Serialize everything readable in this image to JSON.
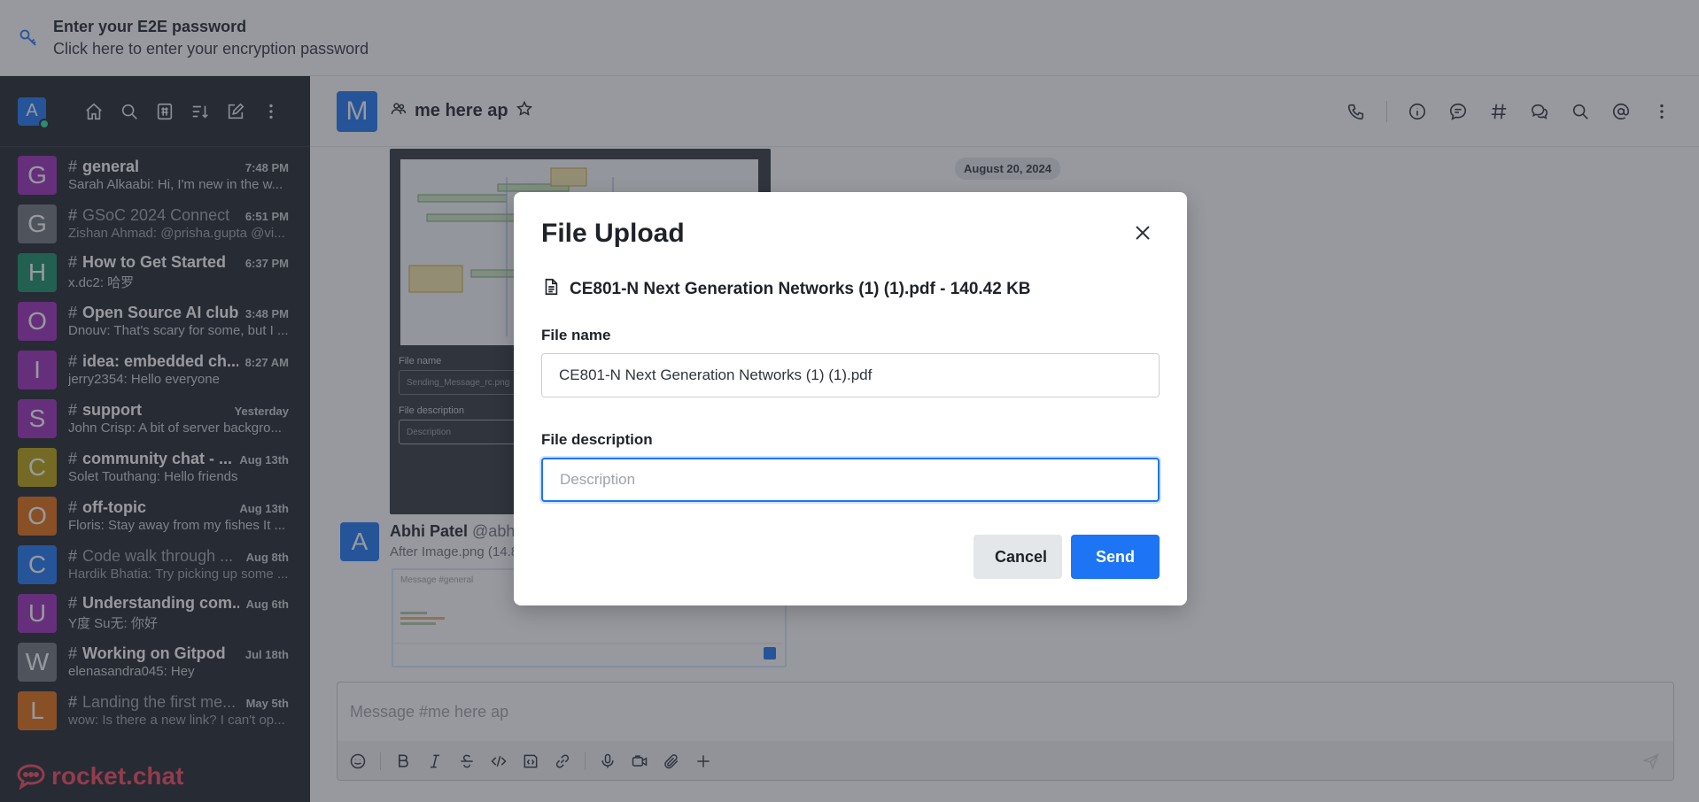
{
  "e2e_banner": {
    "title": "Enter your E2E password",
    "subtitle": "Click here to enter your encryption password"
  },
  "sidebar": {
    "user_initial": "A",
    "brand": "rocket.chat",
    "rooms": [
      {
        "initial": "G",
        "color": "#9c2bb8",
        "name": "general",
        "time": "7:48 PM",
        "last": "Sarah Alkaabi: Hi, I'm new in the w...",
        "muted": false
      },
      {
        "initial": "G",
        "color": "#6c737a",
        "name": "GSoC 2024 Connect",
        "time": "6:51 PM",
        "last": "Zishan Ahmad: @prisha.gupta @vi...",
        "muted": true
      },
      {
        "initial": "H",
        "color": "#158d65",
        "name": "How to Get Started",
        "time": "6:37 PM",
        "last": "x.dc2: 哈罗",
        "muted": false
      },
      {
        "initial": "O",
        "color": "#9c2bb8",
        "name": "Open Source AI club",
        "time": "3:48 PM",
        "last": "Dnouv: That's scary for some, but I ...",
        "muted": false
      },
      {
        "initial": "I",
        "color": "#9c2bb8",
        "name": "idea: embedded ch...",
        "time": "8:27 AM",
        "last": "jerry2354: Hello everyone",
        "muted": false
      },
      {
        "initial": "S",
        "color": "#9c2bb8",
        "name": "support",
        "time": "Yesterday",
        "last": "John Crisp: A bit of server backgro...",
        "muted": false
      },
      {
        "initial": "C",
        "color": "#b8a10b",
        "name": "community chat - ...",
        "time": "Aug 13th",
        "last": "Solet Touthang: Hello friends",
        "muted": false
      },
      {
        "initial": "O",
        "color": "#e26d0e",
        "name": "off-topic",
        "time": "Aug 13th",
        "last": "Floris: Stay away from my fishes It ...",
        "muted": false
      },
      {
        "initial": "C",
        "color": "#1d74f5",
        "name": "Code walk through ...",
        "time": "Aug 8th",
        "last": "Hardik Bhatia: Try picking up some ...",
        "muted": true
      },
      {
        "initial": "U",
        "color": "#9c2bb8",
        "name": "Understanding com...",
        "time": "Aug 6th",
        "last": "Y度 Su无: 你好",
        "muted": false
      },
      {
        "initial": "W",
        "color": "#6c737a",
        "name": "Working on Gitpod",
        "time": "Jul 18th",
        "last": "elenasandra045: Hey",
        "muted": false
      },
      {
        "initial": "L",
        "color": "#e26d0e",
        "name": "Landing the first me...",
        "time": "May 5th",
        "last": "wow: Is there a new link? I can't op...",
        "muted": true
      }
    ]
  },
  "room": {
    "initial": "M",
    "title": "me here ap",
    "date_divider": "August 20, 2024",
    "preview_file_label": "File name",
    "preview_file_value": "Sending_Message_rc.png",
    "preview_desc_label": "File description",
    "preview_desc_placeholder": "Description",
    "message": {
      "initial": "A",
      "author": "Abhi Patel",
      "handle": "@abhi",
      "file": "After Image.png (14.8"
    },
    "thumb_placeholder": "Message #general",
    "composer_placeholder": "Message #me here ap"
  },
  "modal": {
    "title": "File Upload",
    "file_info": "CE801-N Next Generation Networks (1) (1).pdf - 140.42 KB",
    "file_name_label": "File name",
    "file_name_value": "CE801-N Next Generation Networks (1) (1).pdf",
    "file_desc_label": "File description",
    "file_desc_placeholder": "Description",
    "cancel": "Cancel",
    "send": "Send"
  },
  "colors": {
    "accent": "#1d74f5",
    "sidebar_bg": "#1f2329",
    "brand": "#f5455c"
  }
}
